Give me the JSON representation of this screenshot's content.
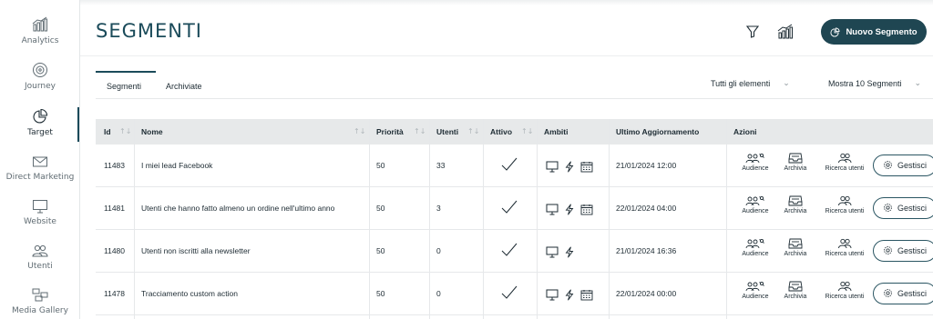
{
  "sidebar": {
    "items": [
      {
        "label": "Analytics",
        "icon": "analytics-icon"
      },
      {
        "label": "Journey",
        "icon": "journey-icon"
      },
      {
        "label": "Target",
        "icon": "pie-chart-icon",
        "active": true
      },
      {
        "label": "Direct Marketing",
        "icon": "mail-icon"
      },
      {
        "label": "Website",
        "icon": "monitor-icon"
      },
      {
        "label": "Utenti",
        "icon": "users-icon"
      },
      {
        "label": "Media Gallery",
        "icon": "media-gallery-icon"
      }
    ]
  },
  "header": {
    "title": "SEGMENTI",
    "new_button_label": "Nuovo Segmento"
  },
  "tabs": [
    {
      "label": "Segmenti",
      "active": true
    },
    {
      "label": "Archiviate",
      "active": false
    }
  ],
  "filters": {
    "scope_select": "Tutti gli elementi",
    "page_size_select": "Mostra 10 Segmenti"
  },
  "table": {
    "columns": [
      "Id",
      "Nome",
      "Priorità",
      "Utenti",
      "Attivo",
      "Ambiti",
      "Ultimo Aggiornamento",
      "Azioni"
    ],
    "actions": [
      "Audience",
      "Archivia",
      "Ricerca utenti"
    ],
    "manage_label": "Gestisci",
    "rows": [
      {
        "id": "11483",
        "nome": "I miei lead Facebook",
        "priorita": "50",
        "utenti": "33",
        "attivo": true,
        "ambiti": [
          "monitor",
          "bolt",
          "calendar"
        ],
        "aggiornamento": "21/01/2024 12:00"
      },
      {
        "id": "11481",
        "nome": "Utenti che hanno fatto almeno un ordine nell'ultimo anno",
        "priorita": "50",
        "utenti": "3",
        "attivo": true,
        "ambiti": [
          "monitor",
          "bolt",
          "calendar"
        ],
        "aggiornamento": "22/01/2024 04:00"
      },
      {
        "id": "11480",
        "nome": "Utenti non iscritti alla newsletter",
        "priorita": "50",
        "utenti": "0",
        "attivo": true,
        "ambiti": [
          "monitor",
          "bolt"
        ],
        "aggiornamento": "21/01/2024 16:36"
      },
      {
        "id": "11478",
        "nome": "Tracciamento custom action",
        "priorita": "50",
        "utenti": "0",
        "attivo": true,
        "ambiti": [
          "monitor",
          "bolt",
          "calendar"
        ],
        "aggiornamento": "22/01/2024 00:00"
      }
    ]
  },
  "colors": {
    "accent": "#1f4652",
    "header_row": "#e7e9ea"
  }
}
